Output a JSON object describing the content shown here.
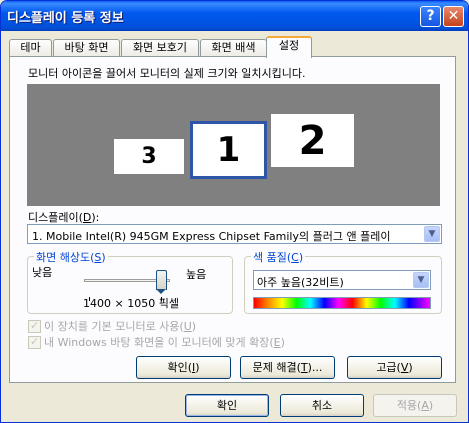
{
  "window": {
    "title": "디스플레이 등록 정보",
    "help_button": "?",
    "close_button": "✕",
    "accent_color": "#0054e3"
  },
  "tabs": [
    {
      "label": "테마"
    },
    {
      "label": "바탕 화면"
    },
    {
      "label": "화면 보호기"
    },
    {
      "label": "화면 배색"
    },
    {
      "label": "설정",
      "active": true
    }
  ],
  "settings": {
    "instruction": "모니터 아이콘을 끌어서 모니터의 실제 크기와 일치시킵니다.",
    "monitors": [
      {
        "number": "3"
      },
      {
        "number": "1",
        "selected": true
      },
      {
        "number": "2"
      }
    ],
    "display_label": "디스플레이(D):",
    "display_label_pre": "디스플레이(",
    "display_label_key": "D",
    "display_label_post": "):",
    "display_value": "1. Mobile Intel(R) 945GM Express Chipset Family의 플러그 앤 플레이",
    "resolution": {
      "group_label_pre": "화면 해상도(",
      "group_label_key": "S",
      "group_label_post": ")",
      "low_label": "낮음",
      "high_label": "높음",
      "value": "1400 × 1050 픽셀",
      "slider_level": 1.0
    },
    "color_quality": {
      "group_label_pre": "색 품질(",
      "group_label_key": "C",
      "group_label_post": ")",
      "selected": "아주 높음(32비트)"
    },
    "checkbox_primary": {
      "label_pre": "이 장치를 기본 모니터로 사용(",
      "label_key": "U",
      "label_post": ")",
      "checked": true,
      "disabled": true
    },
    "checkbox_extend": {
      "label_pre": "내 Windows 바탕 화면을 이 모니터에 맞게 확장(",
      "label_key": "E",
      "label_post": ")",
      "checked": true,
      "disabled": true
    },
    "identify_button": {
      "pre": "확인(",
      "key": "I",
      "post": ")"
    },
    "troubleshoot_button": {
      "pre": "문제 해결(",
      "key": "T",
      "post": ")..."
    },
    "advanced_button": {
      "pre": "고급(",
      "key": "V",
      "post": ")"
    }
  },
  "footer": {
    "ok_button": "확인",
    "cancel_button": "취소",
    "apply_button": {
      "pre": "적용(",
      "key": "A",
      "post": ")"
    }
  }
}
